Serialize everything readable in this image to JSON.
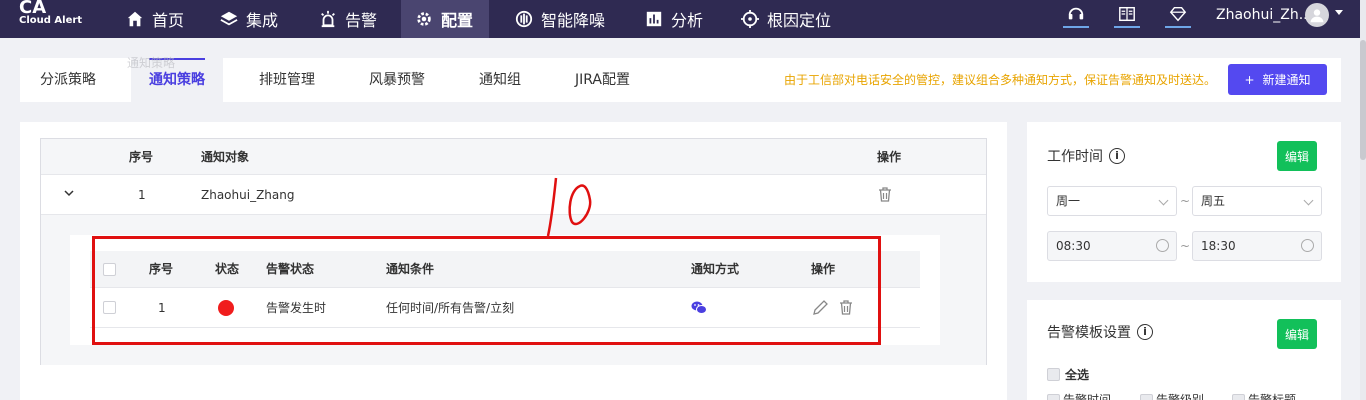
{
  "brand": {
    "logo_main": "CA",
    "logo_sub": "Cloud Alert"
  },
  "nav": {
    "items": [
      {
        "label": "首页",
        "icon": "home-icon"
      },
      {
        "label": "集成",
        "icon": "layers-icon"
      },
      {
        "label": "告警",
        "icon": "alarm-light-icon"
      },
      {
        "label": "配置",
        "icon": "gear-icon",
        "active": true
      },
      {
        "label": "智能降噪",
        "icon": "noise-icon"
      },
      {
        "label": "分析",
        "icon": "chart-icon"
      },
      {
        "label": "根因定位",
        "icon": "crosshair-icon"
      }
    ],
    "user_name": "Zhaohui_Zh..."
  },
  "tabs": {
    "items": [
      "分派策略",
      "通知策略",
      "排班管理",
      "风暴预警",
      "通知组",
      "JIRA配置"
    ],
    "active": "通知策略",
    "notice": "由于工信部对电话安全的管控，建议组合多种通知方式，保证告警通知及时送达。",
    "new_button": "新建通知",
    "ghost_text": "通知策略"
  },
  "outer_table": {
    "headers": {
      "index": "序号",
      "target": "通知对象",
      "action": "操作"
    },
    "rows": [
      {
        "index": "1",
        "target": "Zhaohui_Zhang"
      }
    ]
  },
  "inner_table": {
    "headers": {
      "index": "序号",
      "status": "状态",
      "alert_status": "告警状态",
      "condition": "通知条件",
      "method": "通知方式",
      "action": "操作"
    },
    "rows": [
      {
        "index": "1",
        "status_color": "#f01d1d",
        "alert_status": "告警发生时",
        "condition": "任何时间/所有告警/立刻",
        "method_icon": "wechat-icon"
      }
    ]
  },
  "annotation": {
    "text": "10",
    "color": "#e01010"
  },
  "work_time": {
    "title": "工作时间",
    "edit": "编辑",
    "day_from": "周一",
    "day_to": "周五",
    "time_from": "08:30",
    "time_to": "18:30",
    "separator": "~"
  },
  "alert_template": {
    "title": "告警模板设置",
    "edit": "编辑",
    "select_all": "全选",
    "options": [
      "告警时间",
      "告警级别",
      "告警标题"
    ]
  },
  "colors": {
    "nav_bg": "#2f2a52",
    "primary": "#5449f0",
    "green": "#12c05a",
    "warning": "#e8a400"
  }
}
